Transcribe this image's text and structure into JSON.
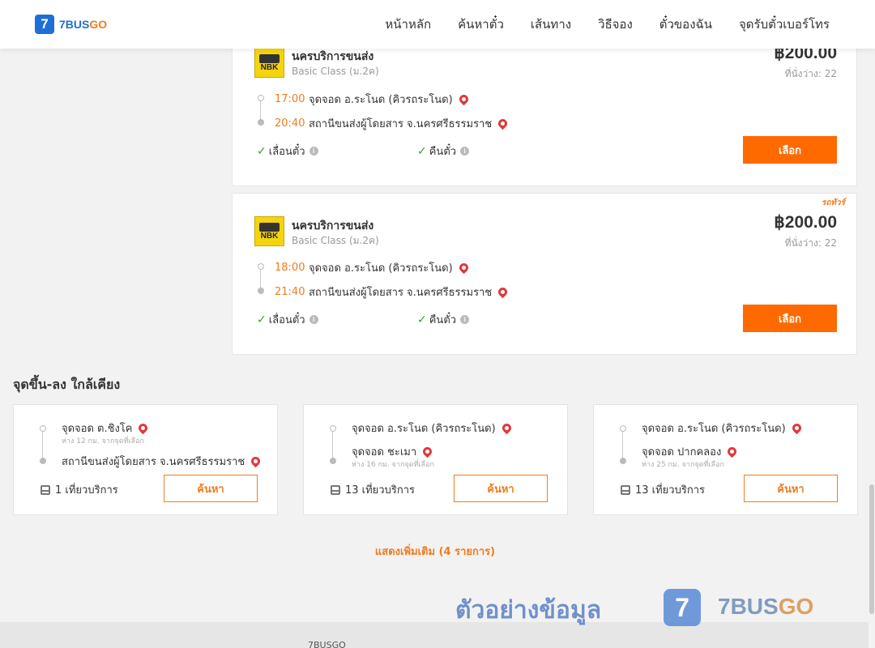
{
  "header": {
    "logo_mark": "7",
    "logo_text_main": "7BUS",
    "logo_text_accent": "GO",
    "nav": [
      "หน้าหลัก",
      "ค้นหาตั๋ว",
      "เส้นทาง",
      "วิธีจอง",
      "ตั๋วของฉัน",
      "จุดรับตั๋วเบอร์โทร"
    ]
  },
  "trips": [
    {
      "operator_logo": "NBK",
      "operator": "นครบริการขนส่ง",
      "class": "Basic Class (ม.2ค)",
      "price": "฿200.00",
      "seats": "ที่นั่งว่าง: 22",
      "depart_time": "17:00",
      "depart_place": "จุดจอด อ.ระโนด (คิวรถระโนด)",
      "arrive_time": "20:40",
      "arrive_place": "สถานีขนส่งผู้โดยสาร จ.นครศรีธรรมราช",
      "feature_1": "เลื่อนตั๋ว",
      "feature_2": "คืนตั๋ว",
      "button": "เลือก",
      "tag": ""
    },
    {
      "operator_logo": "NBK",
      "operator": "นครบริการขนส่ง",
      "class": "Basic Class (ม.2ค)",
      "price": "฿200.00",
      "seats": "ที่นั่งว่าง: 22",
      "depart_time": "18:00",
      "depart_place": "จุดจอด อ.ระโนด (คิวรถระโนด)",
      "arrive_time": "21:40",
      "arrive_place": "สถานีขนส่งผู้โดยสาร จ.นครศรีธรรมราช",
      "feature_1": "เลื่อนตั๋ว",
      "feature_2": "คืนตั๋ว",
      "button": "เลือก",
      "tag": "รถทัวร์"
    }
  ],
  "nearby": {
    "title": "จุดขึ้น-ลง ใกล้เคียง",
    "cards": [
      {
        "from": "จุดจอด ต.ชิงโค",
        "from_sub": "ห่าง 12 กม. จากจุดที่เลือก",
        "to": "สถานีขนส่งผู้โดยสาร จ.นครศรีธรรมราช",
        "to_sub": "",
        "trips": "1 เที่ยวบริการ",
        "button": "ค้นหา"
      },
      {
        "from": "จุดจอด อ.ระโนด (คิวรถระโนด)",
        "from_sub": "",
        "to": "จุดจอด ชะเมา",
        "to_sub": "ห่าง 16 กม. จากจุดที่เลือก",
        "trips": "13 เที่ยวบริการ",
        "button": "ค้นหา"
      },
      {
        "from": "จุดจอด อ.ระโนด (คิวรถระโนด)",
        "from_sub": "",
        "to": "จุดจอด ปากคลอง",
        "to_sub": "ห่าง 25 กม. จากจุดที่เลือก",
        "trips": "13 เที่ยวบริการ",
        "button": "ค้นหา"
      }
    ],
    "show_more": "แสดงเพิ่มเติม (4 รายการ)"
  },
  "watermark": {
    "text": "ตัวอย่างข้อมูล",
    "logo_mark": "7",
    "brand_main": "7BUS",
    "brand_accent": "GO"
  },
  "footer": {
    "text": "7BUSGO"
  },
  "colors": {
    "accent": "#ff6a00",
    "brand_blue": "#1e6ed8",
    "time_orange": "#f07c1e",
    "pin_red": "#e03a3a",
    "check_green": "#3a9d3a"
  }
}
